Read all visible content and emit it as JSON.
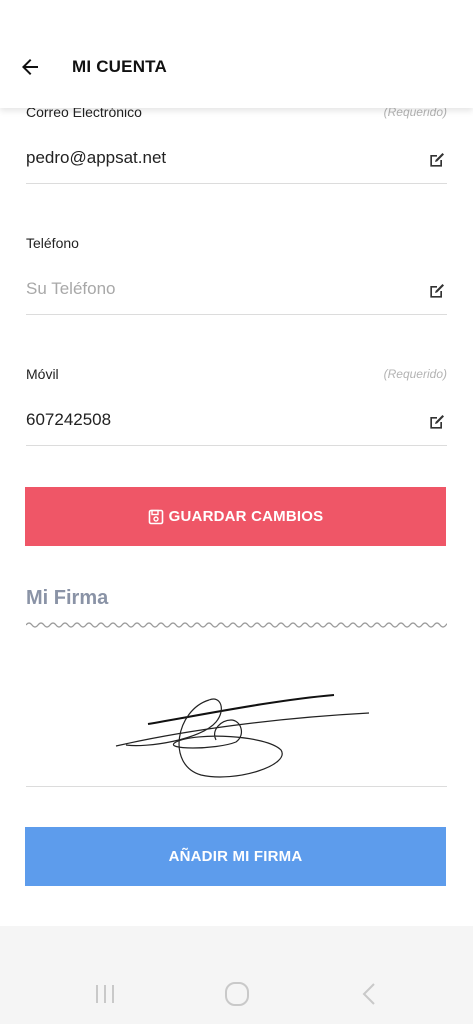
{
  "header": {
    "back_icon": "arrow-left-icon",
    "title": "MI CUENTA"
  },
  "fields": {
    "email": {
      "label": "Correo Electrónico",
      "required": "(Requerido)",
      "value": "pedro@appsat.net",
      "edit_icon": "edit-icon"
    },
    "phone": {
      "label": "Teléfono",
      "placeholder": "Su Teléfono",
      "edit_icon": "edit-icon"
    },
    "mobile": {
      "label": "Móvil",
      "required": "(Requerido)",
      "value": "607242508",
      "edit_icon": "edit-icon"
    }
  },
  "save_button": {
    "label": "GUARDAR CAMBIOS",
    "icon": "floppy-disk-icon",
    "color": "#ef5667"
  },
  "signature": {
    "title": "Mi Firma"
  },
  "add_signature_button": {
    "label": "AÑADIR MI FIRMA",
    "color": "#5d9cec"
  },
  "system_nav": {
    "recent_icon": "recent-apps-icon",
    "home_icon": "home-icon",
    "back_icon": "back-icon"
  }
}
